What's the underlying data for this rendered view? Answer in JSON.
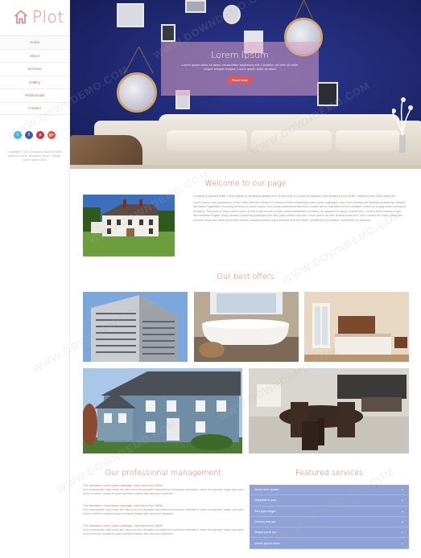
{
  "sidebar": {
    "logo": "Plot",
    "nav": [
      "Home",
      "About",
      "Services",
      "Gallery",
      "Testimonials",
      "Contact"
    ],
    "social": [
      {
        "name": "twitter",
        "label": "t",
        "color": "#3fb4e8"
      },
      {
        "name": "facebook",
        "label": "f",
        "color": "#3b5ca8"
      },
      {
        "name": "pinterest",
        "label": "p",
        "color": "#cf2f3f"
      },
      {
        "name": "google-plus",
        "label": "g+",
        "color": "#e0503e"
      }
    ],
    "copyright": "Copyright © 2014 Company name All rights reserved Lorem Templates Ipsum - Design: Lorem Ipsum Dolor"
  },
  "hero": {
    "title": "Lorem Ipsum",
    "subtitle": "Lorem ipsum dolor sit amet, consectetur adipiscing elit. Curabitur vel sem sit dolor neque semper magna. Lorem ipsum dolor sit amet",
    "button": "Read more"
  },
  "welcome": {
    "title": "Welcome to our page",
    "lead": "Contrary to popular belief, Lorem Ipsum is not simply random text. It has roots in a piece of classical Latin literature from 45 BC, making it over 2000 years old.",
    "body": "Lorem Ipsum was popularised in the 1960s with the release of Letraset sheets containing Lorem Ipsum passages, and more recently with desktop publishing software like Aldus PageMaker including versions of Lorem Ipsum. It is a long established fact that a reader will be distracted by the readable content of a page when looking at its layout. The point of using Lorem Ipsum is that it has a more-or-less normal distribution of letters, as opposed to using Content here, content here, making it look like readable English. Many desktop publishing packages and web page editors now use Lorem Ipsum as their default model text, and a search for lorem ipsum will uncover many web sites still in their infancy. Various versions have evolved over the years, sometimes by accident, sometimes on purpose."
  },
  "offers": {
    "title": "Our best offers",
    "items": [
      "Apartment building",
      "Bathroom",
      "Bedroom",
      "Family house",
      "Dining room"
    ]
  },
  "management": {
    "title": "Our professional management",
    "items": [
      {
        "title": "The standard Lorem Ipsum passage, used since the 1500s",
        "text": "Sed ut perspiciatis unde omnis iste natus error sit voluptatem accusantium doloremque laudantium, totam rem aperiam, eaque ipsa quae ab illo inventore veritatis et quasi architecto beatae vitae dicta sunt explicabo."
      },
      {
        "title": "The standard Lorem Ipsum passage, used since the 1500s",
        "text": "Sed ut perspiciatis unde omnis iste natus error sit voluptatem accusantium doloremque laudantium, totam rem aperiam, eaque ipsa quae ab illo inventore veritatis et quasi architecto beatae vitae dicta sunt explicabo."
      },
      {
        "title": "The standard Lorem Ipsum passage, used since the 1500s",
        "text": "Sed ut perspiciatis unde omnis iste natus error sit voluptatem accusantium doloremque laudantium, totam rem aperiam, eaque ipsa quae ab illo inventore veritatis et quasi architecto beatae vitae dicta sunt explicabo."
      }
    ]
  },
  "services": {
    "title": "Featured services",
    "items": [
      "Nemo enim ipsam",
      "Voluptatem quia",
      "Sed quia magni",
      "Dolores eos qui",
      "Neque porro qui",
      "Lorem ipsum dolor"
    ]
  },
  "watermark": "WWW.DOWNDEMO.COM"
}
